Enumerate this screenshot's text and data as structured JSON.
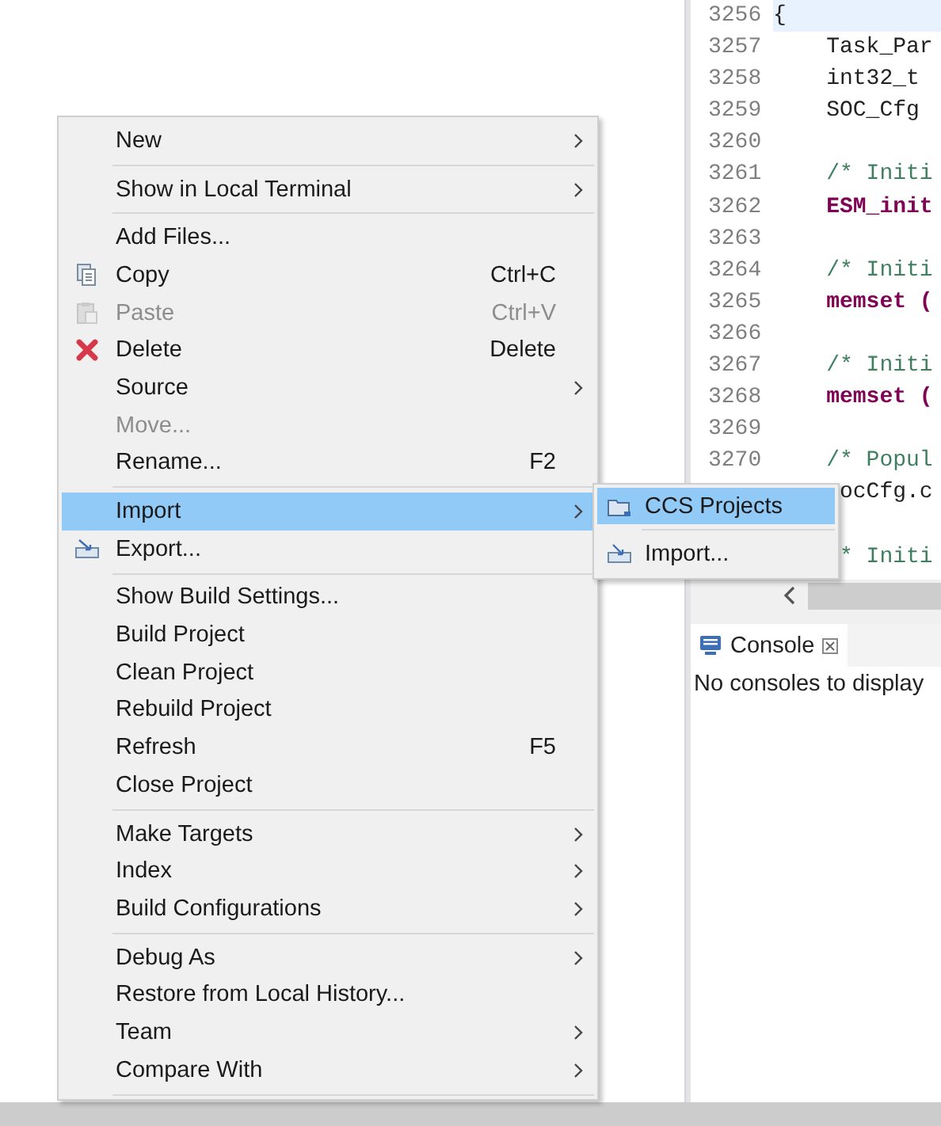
{
  "editor": {
    "lines": [
      {
        "number": "3256",
        "code": "{",
        "kind": "plain",
        "current": true
      },
      {
        "number": "3257",
        "code": "    Task_Par",
        "kind": "plain",
        "current": false
      },
      {
        "number": "3258",
        "code": "    int32_t",
        "kind": "plain",
        "current": false
      },
      {
        "number": "3259",
        "code": "    SOC_Cfg",
        "kind": "plain",
        "current": false
      },
      {
        "number": "3260",
        "kind": "plain",
        "current": false
      },
      {
        "number": "3261",
        "code": "    /* Initi",
        "kind": "comment",
        "current": false
      },
      {
        "number": "3262",
        "code": "    ESM_init",
        "kind": "keyword",
        "current": false
      },
      {
        "number": "3263",
        "kind": "plain",
        "current": false
      },
      {
        "number": "3264",
        "code": "    /* Initi",
        "kind": "comment",
        "current": false
      },
      {
        "number": "3265",
        "code": "    memset (",
        "kind": "keyword",
        "current": false
      },
      {
        "number": "3266",
        "kind": "plain",
        "current": false
      },
      {
        "number": "3267",
        "code": "    /* Initi",
        "kind": "comment",
        "current": false
      },
      {
        "number": "3268",
        "code": "    memset (",
        "kind": "keyword",
        "current": false
      },
      {
        "number": "3269",
        "kind": "plain",
        "current": false
      },
      {
        "number": "3270",
        "code": "    /* Popul",
        "kind": "comment",
        "current": false
      },
      {
        "code": "     ocCfg.c",
        "kind": "plain",
        "current": false
      },
      {
        "kind": "plain",
        "current": false
      },
      {
        "code": "     * Initi",
        "kind": "comment",
        "current": false
      }
    ]
  },
  "console": {
    "tab": {
      "label": "Console"
    },
    "message": "No consoles to display"
  },
  "context_menu": {
    "items": [
      {
        "kind": "item",
        "label": "New",
        "submenu": true,
        "disabled": false,
        "selected": false
      },
      {
        "kind": "separator"
      },
      {
        "kind": "item",
        "label": "Show in Local Terminal",
        "submenu": true,
        "disabled": false,
        "selected": false
      },
      {
        "kind": "separator"
      },
      {
        "kind": "item",
        "label": "Add Files...",
        "submenu": false,
        "disabled": false,
        "selected": false
      },
      {
        "kind": "item",
        "label": "Copy",
        "shortcut": "Ctrl+C",
        "submenu": false,
        "disabled": false,
        "selected": false
      },
      {
        "kind": "item",
        "label": "Paste",
        "shortcut": "Ctrl+V",
        "submenu": false,
        "disabled": true,
        "selected": false
      },
      {
        "kind": "item",
        "label": "Delete",
        "shortcut": "Delete",
        "submenu": false,
        "disabled": false,
        "selected": false
      },
      {
        "kind": "item",
        "label": "Source",
        "submenu": true,
        "disabled": false,
        "selected": false
      },
      {
        "kind": "item",
        "label": "Move...",
        "submenu": false,
        "disabled": true,
        "selected": false
      },
      {
        "kind": "item",
        "label": "Rename...",
        "shortcut": "F2",
        "submenu": false,
        "disabled": false,
        "selected": false
      },
      {
        "kind": "separator"
      },
      {
        "kind": "item",
        "label": "Import",
        "submenu": true,
        "disabled": false,
        "selected": true
      },
      {
        "kind": "item",
        "label": "Export...",
        "submenu": false,
        "disabled": false,
        "selected": false
      },
      {
        "kind": "separator"
      },
      {
        "kind": "item",
        "label": "Show Build Settings...",
        "submenu": false,
        "disabled": false,
        "selected": false
      },
      {
        "kind": "item",
        "label": "Build Project",
        "submenu": false,
        "disabled": false,
        "selected": false
      },
      {
        "kind": "item",
        "label": "Clean Project",
        "submenu": false,
        "disabled": false,
        "selected": false
      },
      {
        "kind": "item",
        "label": "Rebuild Project",
        "submenu": false,
        "disabled": false,
        "selected": false
      },
      {
        "kind": "item",
        "label": "Refresh",
        "shortcut": "F5",
        "submenu": false,
        "disabled": false,
        "selected": false
      },
      {
        "kind": "item",
        "label": "Close Project",
        "submenu": false,
        "disabled": false,
        "selected": false
      },
      {
        "kind": "separator"
      },
      {
        "kind": "item",
        "label": "Make Targets",
        "submenu": true,
        "disabled": false,
        "selected": false
      },
      {
        "kind": "item",
        "label": "Index",
        "submenu": true,
        "disabled": false,
        "selected": false
      },
      {
        "kind": "item",
        "label": "Build Configurations",
        "submenu": true,
        "disabled": false,
        "selected": false
      },
      {
        "kind": "separator"
      },
      {
        "kind": "item",
        "label": "Debug As",
        "submenu": true,
        "disabled": false,
        "selected": false
      },
      {
        "kind": "item",
        "label": "Restore from Local History...",
        "submenu": false,
        "disabled": false,
        "selected": false
      },
      {
        "kind": "item",
        "label": "Team",
        "submenu": true,
        "disabled": false,
        "selected": false
      },
      {
        "kind": "item",
        "label": "Compare With",
        "submenu": true,
        "disabled": false,
        "selected": false
      },
      {
        "kind": "separator"
      }
    ]
  },
  "submenu": {
    "items": [
      {
        "kind": "item",
        "label": "CCS Projects",
        "selected": true
      },
      {
        "kind": "separator"
      },
      {
        "kind": "item",
        "label": "Import...",
        "selected": false
      }
    ]
  }
}
